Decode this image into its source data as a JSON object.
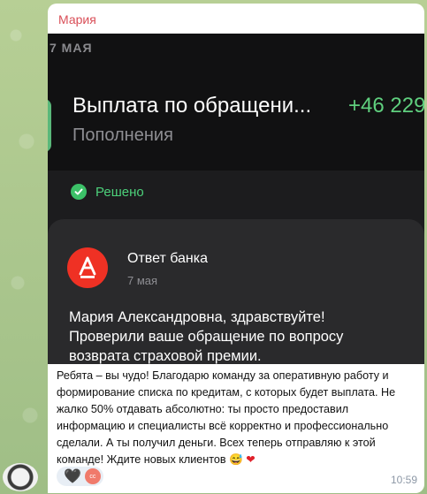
{
  "sender": "Мария",
  "screenshot": {
    "date": "7 МАЯ",
    "payment_title": "Выплата по обращени...",
    "payment_amount": "+46 229",
    "payment_sub": "Пополнения",
    "status": "Решено",
    "bank_name": "Ответ банка",
    "bank_date": "7 мая",
    "bank_message_1": "Мария Александровна, здравствуйте!",
    "bank_message_2": "Проверили ваше обращение по вопросу",
    "bank_message_3": "возврата страховой премии."
  },
  "message": {
    "text": "Ребята – вы чудо! Благодарю команду за оперативную работу и формирование списка по кредитам, с которых будет выплата. Не жалко 50% отдавать абсолютно: ты просто предоставил информацию и специалисты всё корректно и профессионально сделали. А ты получил деньги. Всех теперь отправляю к этой команде! Ждите новых клиентов",
    "emoji_1": "😅",
    "emoji_2": "❤",
    "time": "10:59"
  },
  "reaction": {
    "emoji": "🖤",
    "avatar_initials": "cc"
  },
  "colors": {
    "sender": "#d94f58",
    "amount": "#5fcf7e",
    "bank_logo": "#ef3124"
  }
}
